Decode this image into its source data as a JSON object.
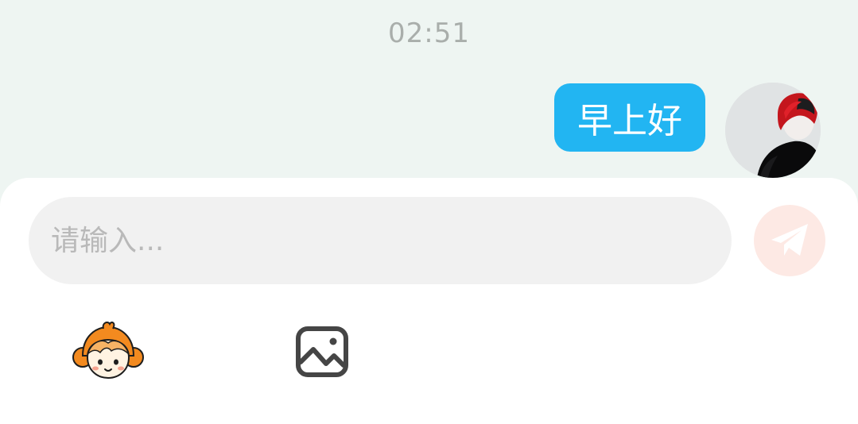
{
  "chat": {
    "timestamp": "02:51",
    "messages": [
      {
        "sender": "self",
        "text": "早上好"
      }
    ]
  },
  "composer": {
    "placeholder": "请输入...",
    "value": ""
  },
  "icons": {
    "send": "paper-plane-icon",
    "emoji": "cartoon-face-icon",
    "image": "image-icon"
  },
  "colors": {
    "chat_background": "#eef5f2",
    "bubble": "#22b5f2",
    "bubble_text": "#ffffff",
    "timestamp": "#a9aeab",
    "input_background": "#f1f1f1",
    "send_button": "#fde9e4",
    "emoji_orange": "#f38a1f"
  }
}
